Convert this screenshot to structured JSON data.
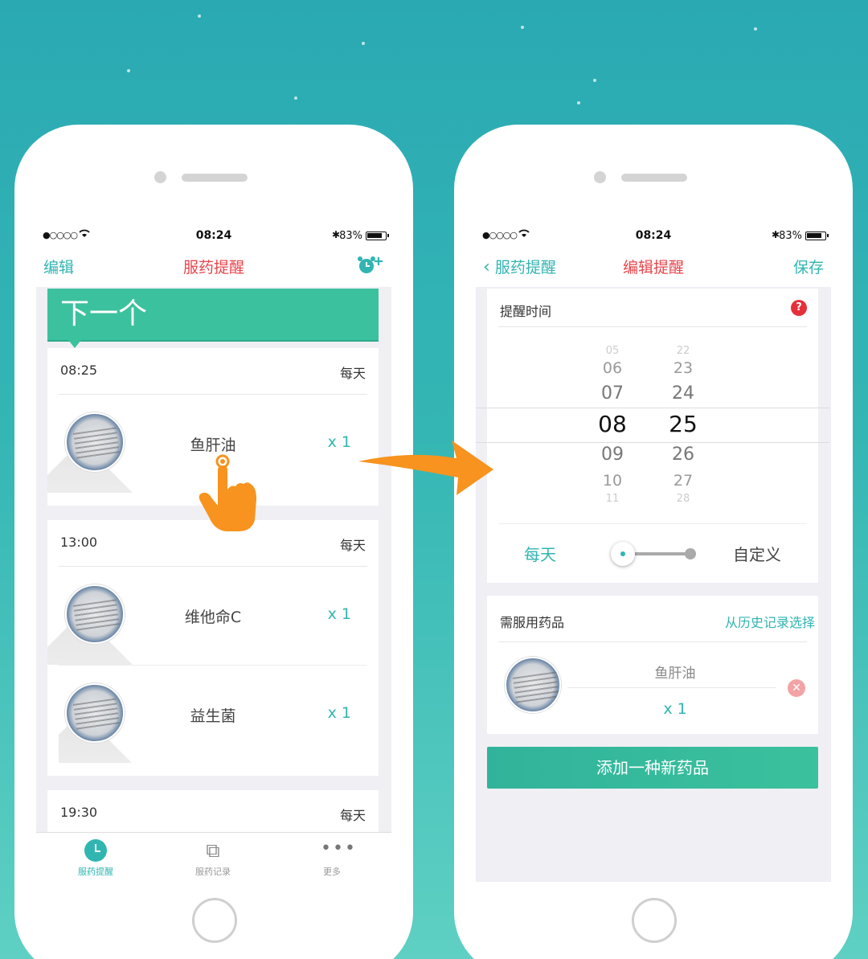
{
  "phones": [
    {
      "status": {
        "signal": "●○○○○",
        "time": "08:24",
        "battery": "83%"
      },
      "nav": {
        "left": "编辑",
        "title": "服药提醒",
        "right_icon": "alarm-add-icon"
      },
      "banner": "下一个",
      "schedules": [
        {
          "time": "08:25",
          "freq": "每天",
          "meds": [
            {
              "name": "鱼肝油",
              "qty": "x 1"
            }
          ]
        },
        {
          "time": "13:00",
          "freq": "每天",
          "meds": [
            {
              "name": "维他命C",
              "qty": "x 1"
            },
            {
              "name": "益生菌",
              "qty": "x 1"
            }
          ]
        },
        {
          "time": "19:30",
          "freq": "每天",
          "meds": []
        }
      ],
      "tabs": [
        {
          "label": "服药提醒",
          "icon": "clock-icon",
          "active": true
        },
        {
          "label": "服药记录",
          "icon": "pill-tag-icon",
          "active": false
        },
        {
          "label": "更多",
          "icon": "more-dots-icon",
          "active": false
        }
      ]
    },
    {
      "status": {
        "signal": "●○○○○",
        "time": "08:24",
        "battery": "83%"
      },
      "nav": {
        "back_label": "服药提醒",
        "title": "编辑提醒",
        "right": "保存"
      },
      "reminder_time": {
        "label": "提醒时间",
        "help": "?",
        "hours": [
          "05",
          "06",
          "07",
          "08",
          "09",
          "10",
          "11"
        ],
        "minutes": [
          "22",
          "23",
          "24",
          "25",
          "26",
          "27",
          "28"
        ],
        "selected_hour": "08",
        "selected_minute": "25"
      },
      "frequency": {
        "left": "每天",
        "right": "自定义",
        "selected": "每天"
      },
      "medicines": {
        "label": "需服用药品",
        "link": "从历史记录选择",
        "items": [
          {
            "name": "鱼肝油",
            "qty": "x 1"
          }
        ]
      },
      "add_button": "添加一种新药品"
    }
  ],
  "colors": {
    "accent": "#31b5b1",
    "title_red": "#e8454c",
    "banner": "#3cc19e",
    "arrow": "#f7931e"
  }
}
